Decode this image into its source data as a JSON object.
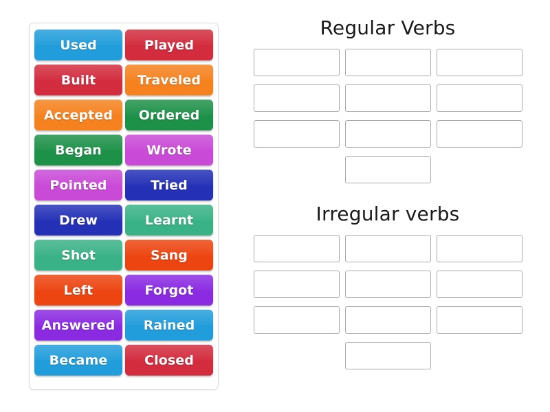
{
  "activity": {
    "type": "group-sort",
    "tile_text_color": "#ffffff"
  },
  "word_bank": {
    "name": "word-bank",
    "tiles": [
      {
        "label": "Used",
        "color": "#229ddb"
      },
      {
        "label": "Played",
        "color": "#d22c3e"
      },
      {
        "label": "Built",
        "color": "#d22c3e"
      },
      {
        "label": "Traveled",
        "color": "#f5821f"
      },
      {
        "label": "Accepted",
        "color": "#f5821f"
      },
      {
        "label": "Ordered",
        "color": "#1e9149"
      },
      {
        "label": "Began",
        "color": "#1e9149"
      },
      {
        "label": "Wrote",
        "color": "#c94ad6"
      },
      {
        "label": "Pointed",
        "color": "#c94ad6"
      },
      {
        "label": "Tried",
        "color": "#2431b6"
      },
      {
        "label": "Drew",
        "color": "#2431b6"
      },
      {
        "label": "Learnt",
        "color": "#3ab287"
      },
      {
        "label": "Shot",
        "color": "#3ab287"
      },
      {
        "label": "Sang",
        "color": "#ec4511"
      },
      {
        "label": "Left",
        "color": "#ec4511"
      },
      {
        "label": "Forgot",
        "color": "#8a2be2"
      },
      {
        "label": "Answered",
        "color": "#8a2be2"
      },
      {
        "label": "Rained",
        "color": "#229ddb"
      },
      {
        "label": "Became",
        "color": "#229ddb"
      },
      {
        "label": "Closed",
        "color": "#d22c3e"
      }
    ]
  },
  "categories": [
    {
      "title": "Regular Verbs",
      "slots": [
        "",
        "",
        "",
        "",
        "",
        "",
        "",
        "",
        "",
        ""
      ]
    },
    {
      "title": "Irregular verbs",
      "slots": [
        "",
        "",
        "",
        "",
        "",
        "",
        "",
        "",
        "",
        ""
      ]
    }
  ]
}
